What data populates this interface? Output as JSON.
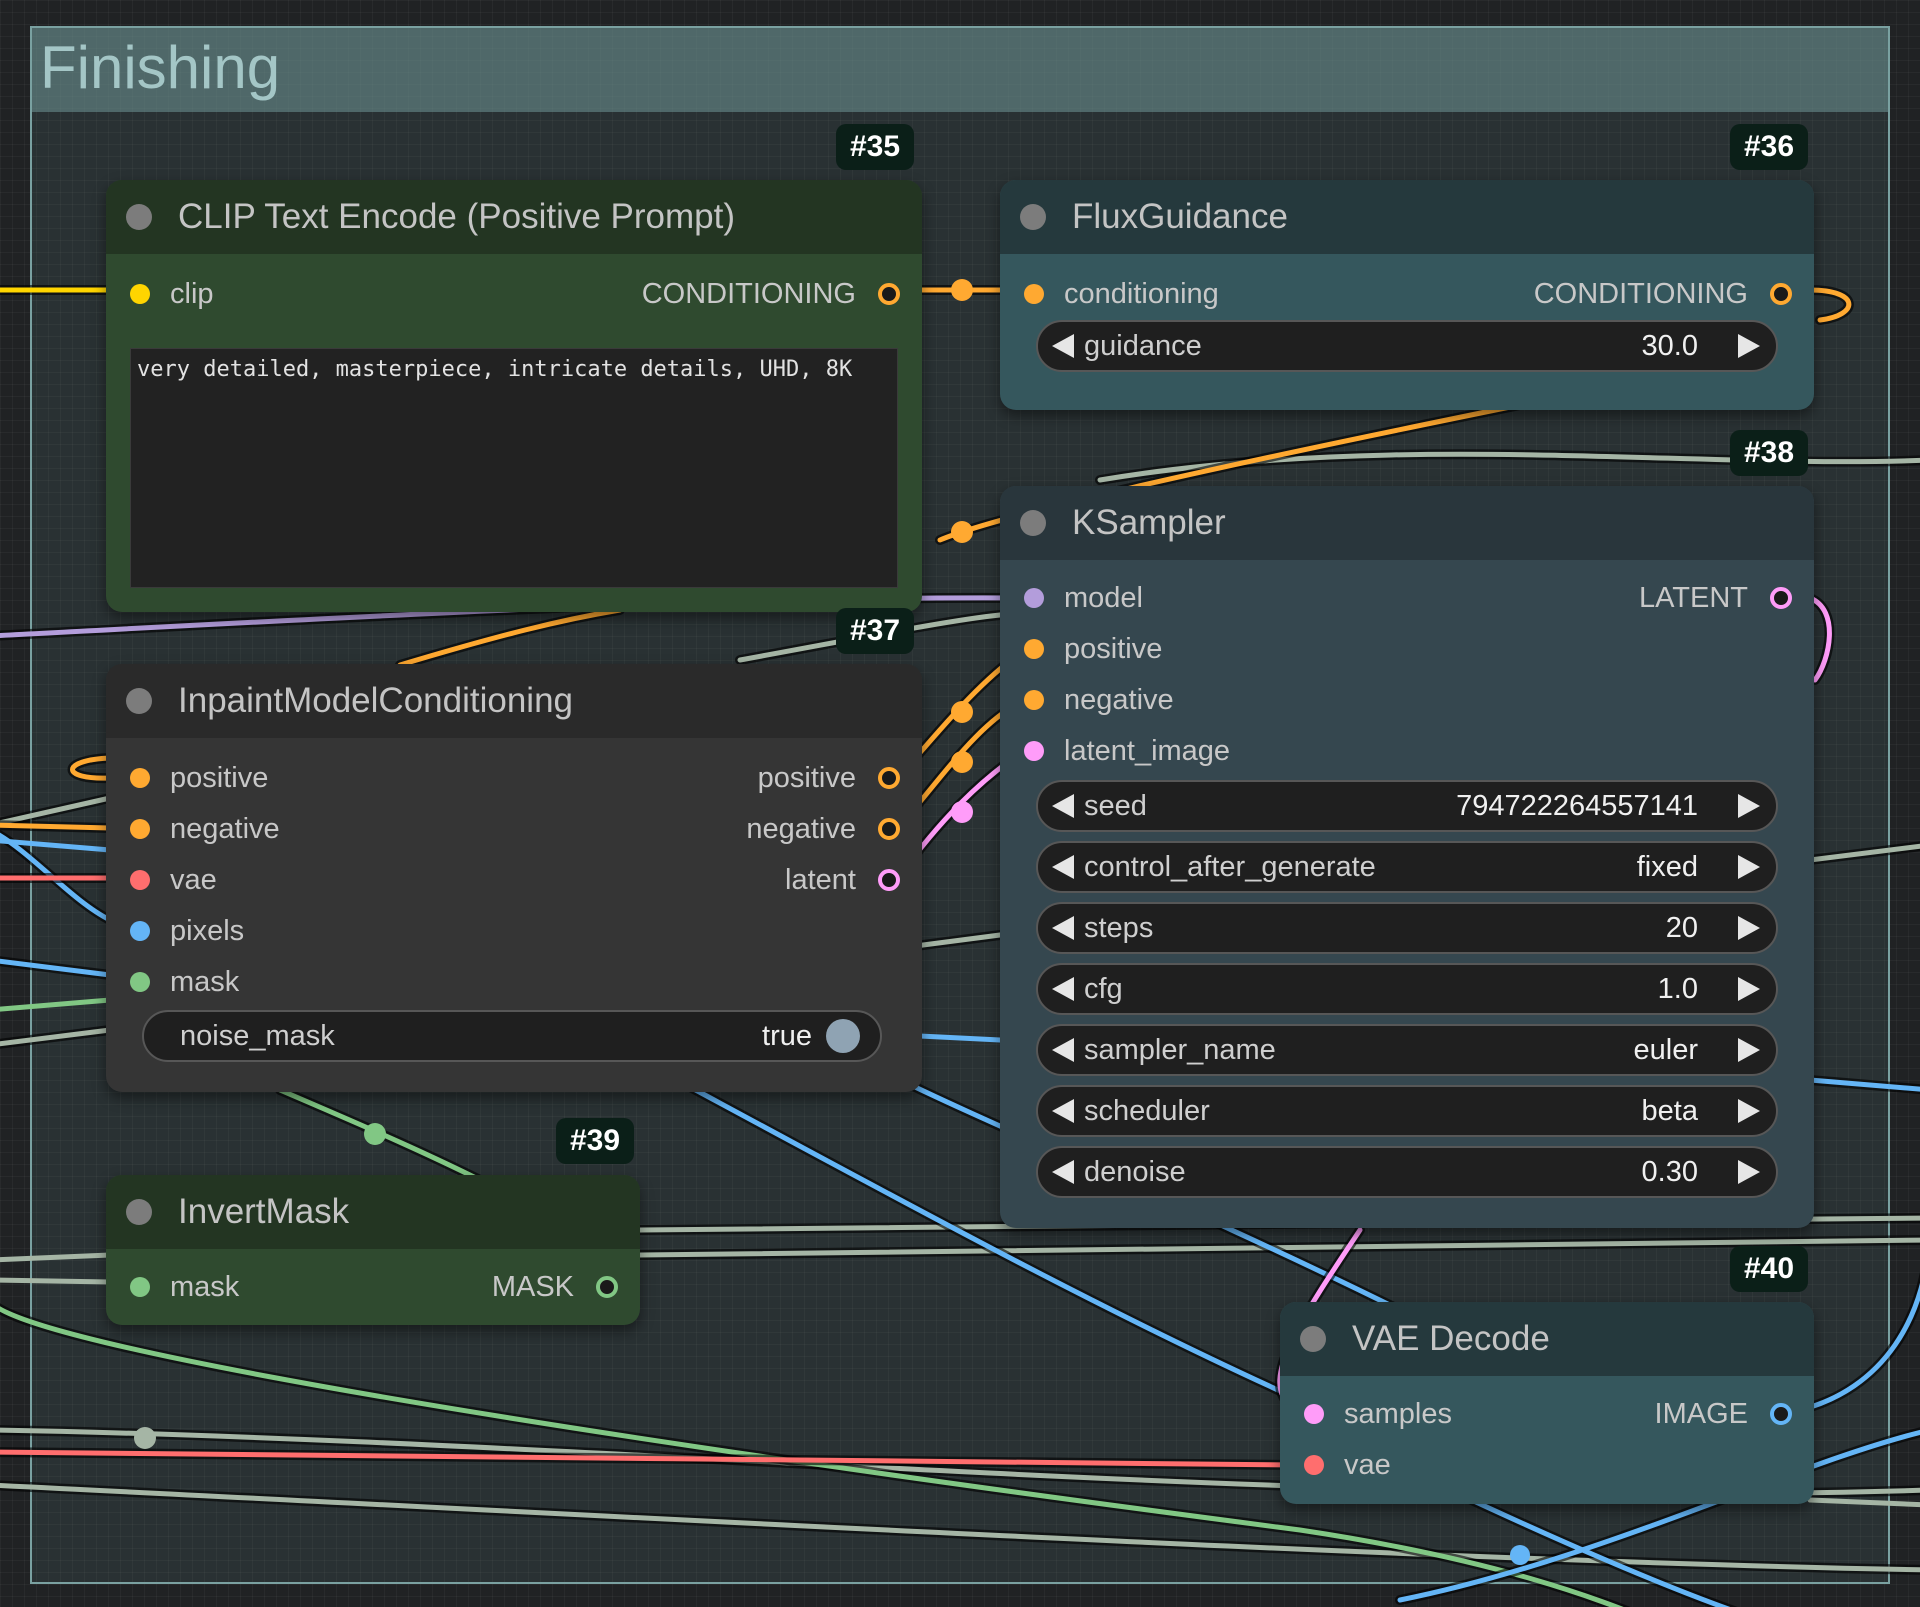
{
  "group": {
    "title": "Finishing"
  },
  "colors": {
    "conditioning": "#ffa931",
    "clip": "#ffd500",
    "model": "#b39ddb",
    "latent": "#ff9cf9",
    "vae": "#ff6e6e",
    "image": "#64b5f6",
    "mask": "#81c784",
    "gray_link": "#a5b5a5"
  },
  "nodes": {
    "n35": {
      "badge": "#35",
      "title": "CLIP Text Encode (Positive Prompt)",
      "input": "clip",
      "output": "CONDITIONING",
      "text": "very detailed, masterpiece, intricate details, UHD, 8K"
    },
    "n36": {
      "badge": "#36",
      "title": "FluxGuidance",
      "input": "conditioning",
      "output": "CONDITIONING",
      "guidance_label": "guidance",
      "guidance_value": "30.0"
    },
    "n37": {
      "badge": "#37",
      "title": "InpaintModelConditioning",
      "inputs": [
        "positive",
        "negative",
        "vae",
        "pixels",
        "mask"
      ],
      "outputs": [
        "positive",
        "negative",
        "latent"
      ],
      "toggle_label": "noise_mask",
      "toggle_value": "true"
    },
    "n38": {
      "badge": "#38",
      "title": "KSampler",
      "inputs": [
        "model",
        "positive",
        "negative",
        "latent_image"
      ],
      "output": "LATENT",
      "widgets": [
        {
          "label": "seed",
          "value": "794722264557141"
        },
        {
          "label": "control_after_generate",
          "value": "fixed"
        },
        {
          "label": "steps",
          "value": "20"
        },
        {
          "label": "cfg",
          "value": "1.0"
        },
        {
          "label": "sampler_name",
          "value": "euler"
        },
        {
          "label": "scheduler",
          "value": "beta"
        },
        {
          "label": "denoise",
          "value": "0.30"
        }
      ]
    },
    "n39": {
      "badge": "#39",
      "title": "InvertMask",
      "input": "mask",
      "output": "MASK"
    },
    "n40": {
      "badge": "#40",
      "title": "VAE Decode",
      "inputs": [
        "samples",
        "vae"
      ],
      "output": "IMAGE"
    }
  }
}
